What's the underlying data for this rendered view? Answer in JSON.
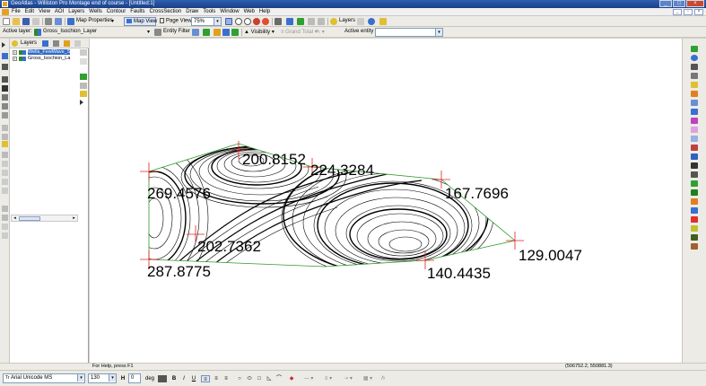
{
  "window": {
    "title": "GeoAtlas - Williston Pro Montage end of course - [Untitled:1]"
  },
  "menu": [
    "File",
    "Edit",
    "View",
    "AOI",
    "Layers",
    "Wells",
    "Contour",
    "Faults",
    "CrossSection",
    "Draw",
    "Tools",
    "Window",
    "Web",
    "Help"
  ],
  "toolbar1": {
    "map_properties": "Map Properties",
    "map_view": "Map View",
    "page_view": "Page View",
    "zoom_value": "75%",
    "layers_label": "Layers"
  },
  "toolbar2": {
    "active_layer_label": "Active layer:",
    "active_layer_value": "Gross_Isochion_Layer",
    "entity_filter": "Entity Filter",
    "visibility": "Visibility",
    "grand_total": "Grand Total",
    "active_entity_label": "Active entity",
    "active_entity_value": ""
  },
  "layers_panel": {
    "title": "Layers",
    "items": [
      {
        "label": "Wells_FewWave_S",
        "selected": true
      },
      {
        "label": "Gross_Isochion_La",
        "selected": false
      }
    ]
  },
  "map": {
    "well_labels": [
      {
        "text": "200.8152"
      },
      {
        "text": "224.3284"
      },
      {
        "text": "269.4576"
      },
      {
        "text": "167.7696"
      },
      {
        "text": "202.7362"
      },
      {
        "text": "287.8775"
      },
      {
        "text": "129.0047"
      },
      {
        "text": "140.4435"
      }
    ]
  },
  "status": {
    "help": "For Help, press F1",
    "coords": "(506752.2, 550881.3)"
  },
  "formatbar": {
    "font": "Arial Unicode MS",
    "size": "130",
    "size2": "0",
    "unit": "deg"
  },
  "colors": {
    "titlebar": "#1f4a9a",
    "boundary": "#2e9a2e",
    "well_marker": "#e02020",
    "contour": "#000000"
  }
}
